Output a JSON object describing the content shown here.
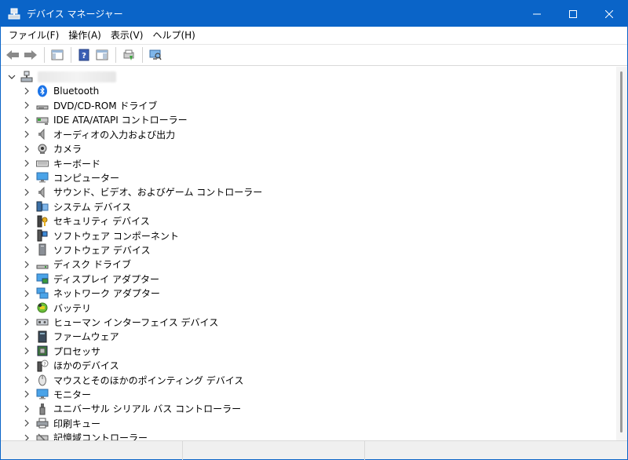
{
  "window": {
    "title": "デバイス マネージャー"
  },
  "menu": [
    "ファイル(F)",
    "操作(A)",
    "表示(V)",
    "ヘルプ(H)"
  ],
  "toolbar": {
    "buttons": [
      "back-icon",
      "forward-icon",
      "show-hide-console-tree-icon",
      "help-icon",
      "action-pane-icon",
      "printer-update-icon",
      "scan-hardware-icon"
    ]
  },
  "tree": {
    "categories": [
      {
        "label": "Bluetooth",
        "icon": "bluetooth-icon"
      },
      {
        "label": "DVD/CD-ROM ドライブ",
        "icon": "dvd-drive-icon"
      },
      {
        "label": "IDE ATA/ATAPI コントローラー",
        "icon": "ide-controller-icon"
      },
      {
        "label": "オーディオの入力および出力",
        "icon": "speaker-icon"
      },
      {
        "label": "カメラ",
        "icon": "camera-icon"
      },
      {
        "label": "キーボード",
        "icon": "keyboard-icon"
      },
      {
        "label": "コンピューター",
        "icon": "monitor-icon"
      },
      {
        "label": "サウンド、ビデオ、およびゲーム コントローラー",
        "icon": "speaker-icon"
      },
      {
        "label": "システム デバイス",
        "icon": "system-device-icon"
      },
      {
        "label": "セキュリティ デバイス",
        "icon": "security-key-icon"
      },
      {
        "label": "ソフトウェア コンポーネント",
        "icon": "software-component-icon"
      },
      {
        "label": "ソフトウェア デバイス",
        "icon": "software-device-icon"
      },
      {
        "label": "ディスク ドライブ",
        "icon": "disk-drive-icon"
      },
      {
        "label": "ディスプレイ アダプター",
        "icon": "display-adapter-icon"
      },
      {
        "label": "ネットワーク アダプター",
        "icon": "network-adapter-icon"
      },
      {
        "label": "バッテリ",
        "icon": "battery-icon"
      },
      {
        "label": "ヒューマン インターフェイス デバイス",
        "icon": "hid-icon"
      },
      {
        "label": "ファームウェア",
        "icon": "firmware-icon"
      },
      {
        "label": "プロセッサ",
        "icon": "processor-icon"
      },
      {
        "label": "ほかのデバイス",
        "icon": "unknown-device-icon"
      },
      {
        "label": "マウスとそのほかのポインティング デバイス",
        "icon": "mouse-icon"
      },
      {
        "label": "モニター",
        "icon": "monitor-icon"
      },
      {
        "label": "ユニバーサル シリアル バス コントローラー",
        "icon": "usb-icon"
      },
      {
        "label": "印刷キュー",
        "icon": "print-queue-icon"
      },
      {
        "label": "記憶域コントローラー",
        "icon": "storage-controller-icon"
      }
    ]
  },
  "colors": {
    "titlebar": "#0a64c8",
    "accent": "#1a73e8"
  }
}
